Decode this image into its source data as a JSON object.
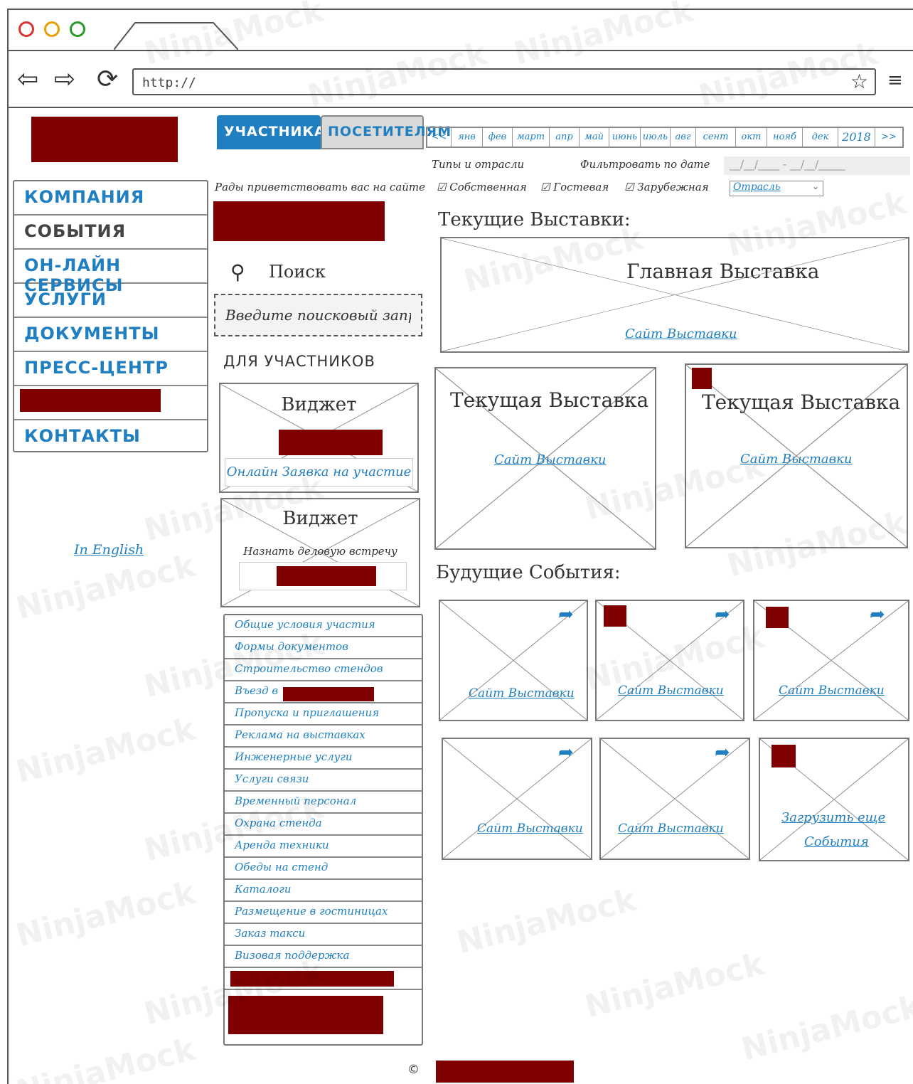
{
  "browser": {
    "url": "http://",
    "star_icon": "star-icon",
    "menu_icon": "hamburger-icon"
  },
  "watermark": "NinjaMock",
  "left_nav": {
    "items": [
      {
        "label": "КОМПАНИЯ",
        "color": "blue"
      },
      {
        "label": "СОБЫТИЯ",
        "color": "grey"
      },
      {
        "label": "ОН-ЛАЙН СЕРВИСЫ",
        "color": "blue"
      },
      {
        "label": "УСЛУГИ",
        "color": "blue"
      },
      {
        "label": "ДОКУМЕНТЫ",
        "color": "blue"
      },
      {
        "label": "ПРЕСС-ЦЕНТР",
        "color": "blue"
      },
      {
        "label": "",
        "color": "redacted"
      },
      {
        "label": "КОНТАКТЫ",
        "color": "blue"
      }
    ],
    "english_link": "In English"
  },
  "tabs": {
    "participants": "УЧАСТНИКАМ",
    "visitors": "ПОСЕТИТЕЛЯМ"
  },
  "months": [
    "<<",
    "янв",
    "фев",
    "март",
    "апр",
    "май",
    "июнь",
    "июль",
    "авг",
    "сент",
    "окт",
    "нояб",
    "дек",
    "2018",
    ">>"
  ],
  "filters": {
    "types_label": "Типы и отрасли",
    "date_label": "Фильтровать по дате",
    "date_value": "__/__/____ - __/__/_____",
    "checkboxes": [
      "Собственная",
      "Гостевая",
      "Зарубежная"
    ],
    "industry_select": "Отрасль"
  },
  "middle": {
    "welcome": "Рады приветствовать вас на сайте",
    "search_label": "Поиск",
    "search_placeholder": "Введите поисковый запрос",
    "for_participants": "ДЛЯ УЧАСТНИКОВ",
    "widget1": {
      "title": "Виджет",
      "link": "Онлайн Заявка на участие"
    },
    "widget2": {
      "title": "Виджет",
      "subtitle": "Назнать деловую встречу"
    },
    "links": [
      "Общие условия участия",
      "Формы документов",
      "Строительство стендов",
      "Въезд в",
      "Пропуска и приглашения",
      "Реклама на выставках",
      "Инженерные услуги",
      "Услуги связи",
      "Временный персонал",
      "Охрана стенда",
      "Аренда техники",
      "Обеды на стенд",
      "Каталоги",
      "Размещение в гостиницах",
      "Заказ такси",
      "Визовая поддержка"
    ]
  },
  "right": {
    "current_heading": "Текущие  Выставки:",
    "main_title": "Главная Выставка",
    "main_link": "Сайт Выставки",
    "current_cards": [
      {
        "title": "Текущая Выставка",
        "link": "Сайт Выставки"
      },
      {
        "title": "Текущая Выставка",
        "link": "Сайт Выставки"
      }
    ],
    "future_heading": "Будущие События:",
    "future_cards": [
      {
        "link": "Сайт Выставки"
      },
      {
        "link": "Сайт Выставки"
      },
      {
        "link": "Сайт Выставки"
      },
      {
        "link": "Сайт Выставки"
      },
      {
        "link": "Сайт Выставки"
      }
    ],
    "load_more_line1": "Загрузить еще",
    "load_more_line2": "События"
  },
  "footer": {
    "copyright": "©"
  },
  "colors": {
    "link_blue": "#1f7fc0",
    "redaction": "#7f0000",
    "active_tab": "#1f7fc0",
    "inactive_tab": "#d9d9d9"
  }
}
